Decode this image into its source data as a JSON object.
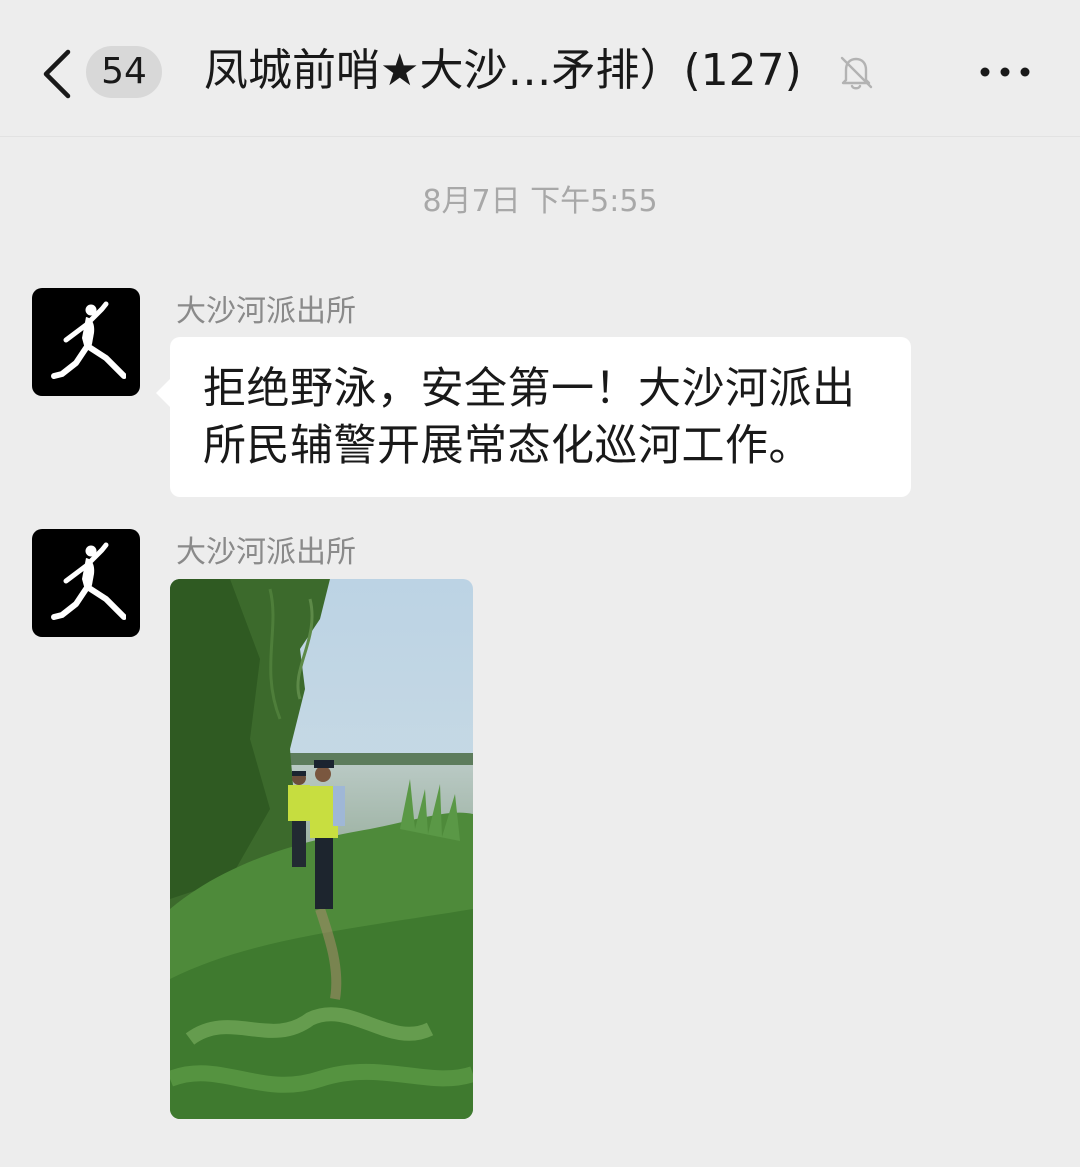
{
  "header": {
    "back_icon": "chevron-left-icon",
    "unread_count": "54",
    "title": "凤城前哨★大沙…矛排）(127)",
    "mute_icon": "bell-off-icon",
    "more_icon": "more-dots-icon"
  },
  "chat": {
    "timestamp": "8月7日 下午5:55",
    "messages": [
      {
        "sender": "大沙河派出所",
        "avatar_icon": "jumpman-logo-icon",
        "type": "text",
        "text": "拒绝野泳，安全第一！大沙河派出所民辅警开展常态化巡河工作。"
      },
      {
        "sender": "大沙河派出所",
        "avatar_icon": "jumpman-logo-icon",
        "type": "image",
        "image_desc": "two officers in reflective vests patrolling a riverbank"
      }
    ]
  },
  "colors": {
    "background": "#ededed",
    "bubble": "#ffffff",
    "text": "#191919",
    "muted_text": "#8a8a8a",
    "timestamp_text": "#a8a8a8"
  }
}
